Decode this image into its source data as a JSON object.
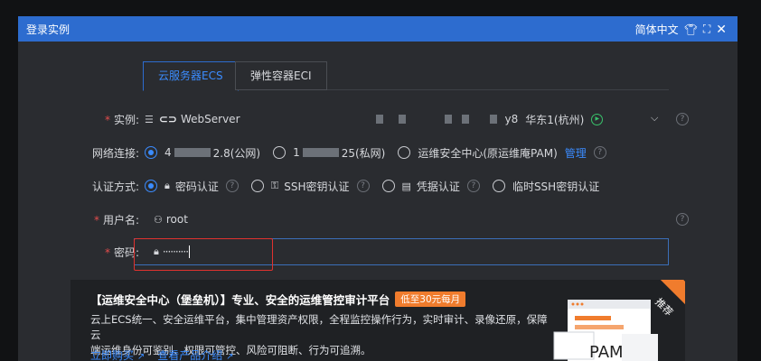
{
  "titlebar": {
    "title": "登录实例",
    "language": "简体中文"
  },
  "tabs": [
    {
      "label": "云服务器ECS",
      "active": true
    },
    {
      "label": "弹性容器ECI",
      "active": false
    }
  ],
  "instance": {
    "label": "实例:",
    "name": "WebServer",
    "id_suffix": "y8",
    "region": "华东1(杭州)"
  },
  "network": {
    "label": "网络连接:",
    "public_suffix": "2.8(公网)",
    "public_prefix": "4",
    "private_prefix": "1",
    "private_suffix": "25(私网)",
    "bastion": "运维安全中心(原运维庵PAM)",
    "manage": "管理"
  },
  "auth": {
    "label": "认证方式:",
    "options": [
      "密码认证",
      "SSH密钥认证",
      "凭据认证",
      "临时SSH密钥认证"
    ]
  },
  "username": {
    "label": "用户名:",
    "value": "root"
  },
  "password": {
    "label": "密码:",
    "value": "··········"
  },
  "banner": {
    "heading": "【运维安全中心（堡垒机）】专业、安全的运维管控审计平台",
    "badge": "低至30元每月",
    "line1": "云上ECS统一、安全运维平台，集中管理资产权限，全程监控操作行为，实时审计、录像还原，保障云",
    "line2": "端运维身份可鉴别、权限可管控、风险可阻断、行为可追溯。",
    "link1": "立即购买",
    "link2": "查看产品介绍",
    "ribbon": "推荐",
    "illus_text": "PAM"
  },
  "colors": {
    "accent": "#3b8cff",
    "titlebar": "#2d6ccf",
    "required": "#e34d4d",
    "highlight": "#e0322f",
    "badge": "#f07c2d"
  }
}
